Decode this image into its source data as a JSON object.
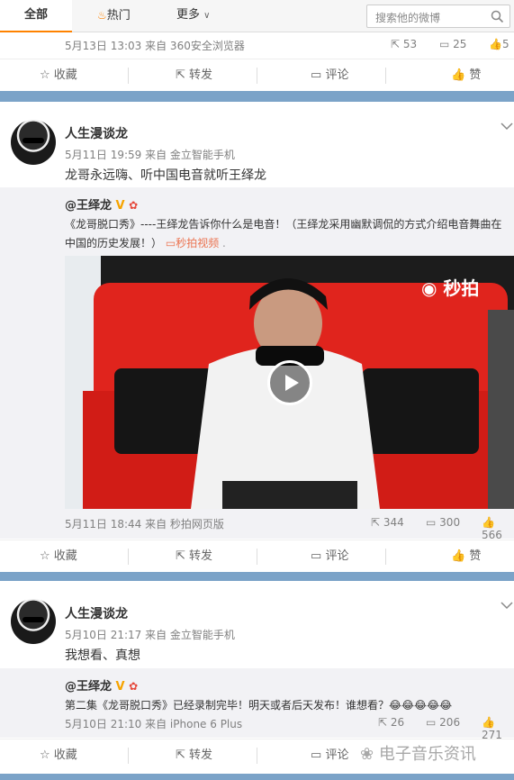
{
  "tabs": {
    "all": "全部",
    "hot": "热门",
    "more": "更多"
  },
  "search": {
    "placeholder": "搜索他的微博"
  },
  "colors": {
    "accent": "#ff8200",
    "link": "#eb7350",
    "stripe": "#7ba3c8"
  },
  "post0": {
    "meta": "5月13日 13:03 来自 360安全浏览器",
    "reposts": "53",
    "comments": "25",
    "likes": "5",
    "actions": {
      "collect": "收藏",
      "forward": "转发",
      "comment": "评论",
      "like": "赞"
    }
  },
  "post1": {
    "author": "人生漫谈龙",
    "meta": "5月11日 19:59 来自 金立智能手机",
    "text": "龙哥永远嗨、听中国电音就听王绎龙",
    "repost_author": "@王绎龙",
    "repost_text": "《龙哥脱口秀》----王绎龙告诉你什么是电音！（王绎龙采用幽默调侃的方式介绍电音舞曲在中国的历史发展！）",
    "repost_link": "秒拍视频",
    "video_watermark": "秒拍",
    "repost_meta": "5月11日 18:44 来自 秒拍网页版",
    "reposts": "344",
    "comments": "300",
    "likes": "566",
    "actions": {
      "collect": "收藏",
      "forward": "转发",
      "comment": "评论",
      "like": "赞"
    }
  },
  "post2": {
    "author": "人生漫谈龙",
    "meta": "5月10日 21:17 来自 金立智能手机",
    "text": "我想看、真想",
    "repost_author": "@王绎龙",
    "repost_text": "第二集《龙哥脱口秀》已经录制完毕！明天或者后天发布！谁想看？",
    "emoji": "😂😂😂😂😂",
    "repost_meta": "5月10日 21:10 来自 iPhone 6 Plus",
    "reposts": "26",
    "comments": "206",
    "likes": "271",
    "actions": {
      "collect": "收藏",
      "forward": "转发",
      "comment": "评论",
      "like": "赞"
    }
  },
  "watermark": "电子音乐资讯"
}
